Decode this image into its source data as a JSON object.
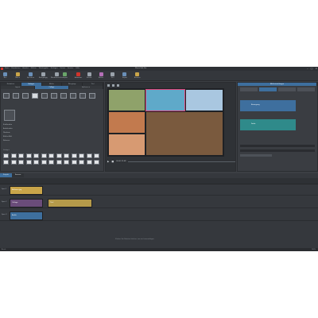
{
  "app": {
    "window_title": "Movie Edit Pro",
    "menu": [
      "Datei",
      "Bearbeiten",
      "Ansicht",
      "Effekte",
      "Wiedergabe",
      "Einfügen",
      "Extras",
      "Fenster",
      "Hilfe"
    ],
    "win_controls": [
      "–",
      "□",
      "×"
    ]
  },
  "toolbar": {
    "items": [
      {
        "label": "Neu",
        "icon": "new-icon",
        "color": "#6a8fb8"
      },
      {
        "label": "Öffnen",
        "icon": "open-icon",
        "color": "#c9a54a"
      },
      {
        "label": "Speichern",
        "icon": "save-icon",
        "color": "#6a8fb8"
      },
      {
        "label": "Rückgängig",
        "icon": "undo-icon",
        "color": "#9aa2ab"
      },
      {
        "label": "Wiederherstellen",
        "icon": "redo-icon",
        "color": "#9aa2ab"
      },
      {
        "label": "Import",
        "icon": "import-icon",
        "color": "#6aa56a"
      },
      {
        "label": "Aufnahme",
        "icon": "record-icon",
        "color": "#d0342c"
      },
      {
        "label": "Schnitt",
        "icon": "cut-icon",
        "color": "#9aa2ab"
      },
      {
        "label": "Effekte",
        "icon": "fx-icon",
        "color": "#b56fb8"
      },
      {
        "label": "Titel",
        "icon": "title-icon",
        "color": "#9aa2ab"
      },
      {
        "label": "Export",
        "icon": "export-icon",
        "color": "#6a8fb8"
      },
      {
        "label": "Brennen",
        "icon": "burn-icon",
        "color": "#c9a54a"
      }
    ]
  },
  "left_panel": {
    "tabs": [
      "Mediathek",
      "Vorlagen",
      "Effekte",
      "Übergänge",
      "Titel"
    ],
    "sub_tabs": [
      "Layout",
      "Collage",
      "Splitscreen"
    ],
    "list_items": [
      "Einblenden",
      "Ausblenden",
      "Diashow",
      "Bild-in-Bild",
      "Rahmen"
    ],
    "section_label": "Vorlagen"
  },
  "preview": {
    "timecode": "00:00:12:08",
    "photos": [
      {
        "name": "road",
        "color": "#8fa26a"
      },
      {
        "name": "coast",
        "color": "#5fa9c9"
      },
      {
        "name": "city",
        "color": "#a9c7e0"
      },
      {
        "name": "village",
        "color": "#c27a4e"
      },
      {
        "name": "balloons",
        "color": "#d79a72"
      },
      {
        "name": "canyon",
        "color": "#7a5a3e"
      }
    ]
  },
  "right_panel": {
    "title": "Effekteinstellungen",
    "blocks": [
      {
        "label": "Bewegung",
        "color": "#3e6f9e"
      },
      {
        "label": "Farbe",
        "color": "#2f8a8a"
      }
    ]
  },
  "timeline": {
    "tabs": [
      "Projekt",
      "Szenen"
    ],
    "tracks": [
      {
        "name": "Spur 1",
        "clips": [
          {
            "label": "Balloons.jpg",
            "color": "#c9a54a"
          }
        ]
      },
      {
        "name": "Spur 2",
        "clips": [
          {
            "label": "Collage",
            "color": "#6a4c7a"
          },
          {
            "label": "Titel",
            "color": "#b59a4a"
          }
        ]
      },
      {
        "name": "Spur 3",
        "clips": [
          {
            "label": "Audio",
            "color": "#3e6f9e"
          }
        ]
      }
    ],
    "hint": "Ziehen Sie Dateien hierher, um sie hinzuzufügen"
  },
  "status": {
    "left": "Bereit",
    "right": "100%"
  }
}
